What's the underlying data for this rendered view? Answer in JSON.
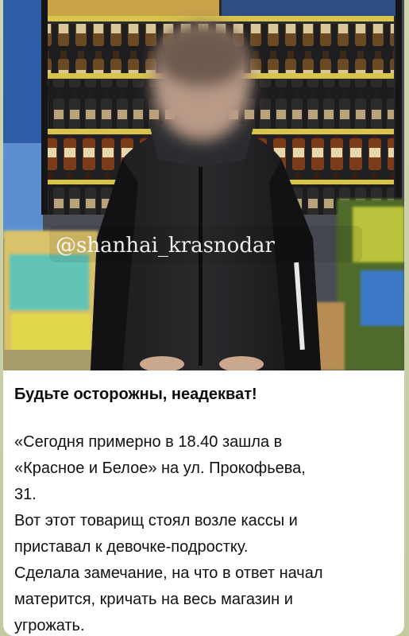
{
  "post": {
    "watermark": "@shanhai_krasnodar",
    "title": "Будьте осторожны, неадекват!",
    "body_lines": [
      "«Сегодня примерно в 18.40 зашла в",
      "«Красное и Белое» на ул. Прокофьева,",
      "31.",
      "Вот этот товарищ стоял возле кассы и",
      "приставал к девочке-подростку.",
      "Сделала замечание, на что в ответ начал",
      "матерится, кричать на весь магазин и",
      "угрожать."
    ]
  },
  "colors": {
    "chat_background": "#c9cfa8",
    "bubble_background": "#ffffff",
    "text": "#111111"
  },
  "icons": {
    "photo": "store-photo-with-blurred-person"
  }
}
